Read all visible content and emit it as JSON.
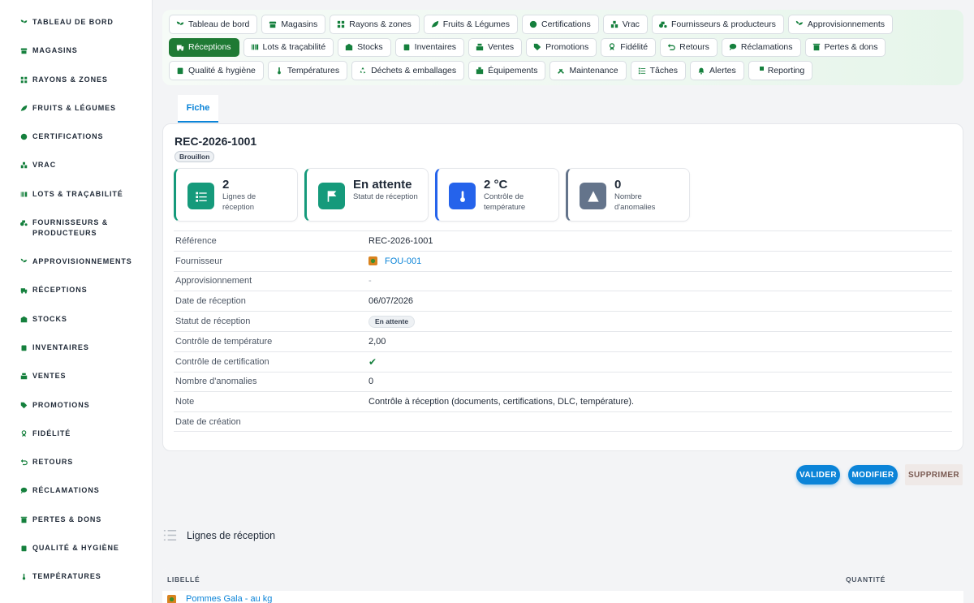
{
  "sidebar": {
    "items": [
      {
        "label": "Tableau de bord",
        "icon": "sprout-icon"
      },
      {
        "label": "Magasins",
        "icon": "store-icon"
      },
      {
        "label": "Rayons & zones",
        "icon": "grid-icon"
      },
      {
        "label": "Fruits & Légumes",
        "icon": "leaf-icon"
      },
      {
        "label": "Certifications",
        "icon": "seal-icon"
      },
      {
        "label": "Vrac",
        "icon": "boxes-icon"
      },
      {
        "label": "Lots & traçabilité",
        "icon": "barcode-icon"
      },
      {
        "label": "Fournisseurs & producteurs",
        "icon": "tractor-icon"
      },
      {
        "label": "Approvisionnements",
        "icon": "seedling-icon"
      },
      {
        "label": "Réceptions",
        "icon": "truck-icon"
      },
      {
        "label": "Stocks",
        "icon": "warehouse-icon"
      },
      {
        "label": "Inventaires",
        "icon": "clipboard-icon"
      },
      {
        "label": "Ventes",
        "icon": "cash-register-icon"
      },
      {
        "label": "Promotions",
        "icon": "tag-icon"
      },
      {
        "label": "Fidélité",
        "icon": "award-icon"
      },
      {
        "label": "Retours",
        "icon": "undo-icon"
      },
      {
        "label": "Réclamations",
        "icon": "comment-icon"
      },
      {
        "label": "Pertes & dons",
        "icon": "trash-icon"
      },
      {
        "label": "Qualité & hygiène",
        "icon": "clipboard-check-icon"
      },
      {
        "label": "Températures",
        "icon": "thermometer-icon"
      }
    ]
  },
  "topnav": {
    "chips": [
      {
        "label": "Tableau de bord",
        "icon": "sprout-icon",
        "active": false
      },
      {
        "label": "Magasins",
        "icon": "store-icon",
        "active": false
      },
      {
        "label": "Rayons & zones",
        "icon": "grid-icon",
        "active": false
      },
      {
        "label": "Fruits & Légumes",
        "icon": "leaf-icon",
        "active": false
      },
      {
        "label": "Certifications",
        "icon": "seal-icon",
        "active": false
      },
      {
        "label": "Vrac",
        "icon": "boxes-icon",
        "active": false
      },
      {
        "label": "Fournisseurs & producteurs",
        "icon": "tractor-icon",
        "active": false
      },
      {
        "label": "Approvisionnements",
        "icon": "seedling-icon",
        "active": false
      },
      {
        "label": "Réceptions",
        "icon": "truck-icon",
        "active": true
      },
      {
        "label": "Lots & traçabilité",
        "icon": "barcode-icon",
        "active": false
      },
      {
        "label": "Stocks",
        "icon": "warehouse-icon",
        "active": false
      },
      {
        "label": "Inventaires",
        "icon": "clipboard-icon",
        "active": false
      },
      {
        "label": "Ventes",
        "icon": "cash-register-icon",
        "active": false
      },
      {
        "label": "Promotions",
        "icon": "tag-icon",
        "active": false
      },
      {
        "label": "Fidélité",
        "icon": "award-icon",
        "active": false
      },
      {
        "label": "Retours",
        "icon": "undo-icon",
        "active": false
      },
      {
        "label": "Réclamations",
        "icon": "comment-icon",
        "active": false
      },
      {
        "label": "Pertes & dons",
        "icon": "trash-icon",
        "active": false
      },
      {
        "label": "Qualité & hygiène",
        "icon": "clipboard-check-icon",
        "active": false
      },
      {
        "label": "Températures",
        "icon": "thermometer-icon",
        "active": false
      },
      {
        "label": "Déchets & emballages",
        "icon": "recycle-icon",
        "active": false
      },
      {
        "label": "Équipements",
        "icon": "equipment-icon",
        "active": false
      },
      {
        "label": "Maintenance",
        "icon": "tools-icon",
        "active": false
      },
      {
        "label": "Tâches",
        "icon": "tasks-icon",
        "active": false
      },
      {
        "label": "Alertes",
        "icon": "bell-icon",
        "active": false
      },
      {
        "label": "Reporting",
        "icon": "pie-chart-icon",
        "active": false
      }
    ]
  },
  "tabs": {
    "fiche": "Fiche"
  },
  "record": {
    "title": "REC-2026-1001",
    "badge": "Brouillon",
    "kpis": [
      {
        "value": "2",
        "label": "Lignes de réception",
        "icon": "list-icon",
        "color": "#159a7b"
      },
      {
        "value": "En attente",
        "label": "Statut de réception",
        "icon": "flag-icon",
        "color": "#159a7b"
      },
      {
        "value": "2 °C",
        "label": "Contrôle de température",
        "icon": "thermometer-icon",
        "color": "#2563eb"
      },
      {
        "value": "0",
        "label": "Nombre d'anomalies",
        "icon": "warning-icon",
        "color": "#64748b"
      }
    ],
    "fields": {
      "reference": {
        "label": "Référence",
        "value": "REC-2026-1001"
      },
      "fournisseur": {
        "label": "Fournisseur",
        "value": "FOU-001"
      },
      "approvisionnement": {
        "label": "Approvisionnement",
        "value": "-"
      },
      "date_reception": {
        "label": "Date de réception",
        "value": "06/07/2026"
      },
      "statut": {
        "label": "Statut de réception",
        "value": "En attente"
      },
      "temperature": {
        "label": "Contrôle de température",
        "value": "2,00"
      },
      "certification": {
        "label": "Contrôle de certification",
        "value": "✔"
      },
      "anomalies": {
        "label": "Nombre d'anomalies",
        "value": "0"
      },
      "note": {
        "label": "Note",
        "value": "Contrôle à réception (documents, certifications, DLC, température)."
      },
      "date_creation": {
        "label": "Date de création",
        "value": ""
      }
    }
  },
  "actions": {
    "valider": "Valider",
    "modifier": "Modifier",
    "supprimer": "Supprimer"
  },
  "lines": {
    "title": "Lignes de réception",
    "columns": {
      "libelle": "Libellé",
      "quantite": "Quantité"
    },
    "rows": [
      {
        "libelle": "Pommes Gala - au kg"
      }
    ]
  },
  "colors": {
    "accent": "#0b84d8",
    "brand_green": "#1f7a34"
  }
}
